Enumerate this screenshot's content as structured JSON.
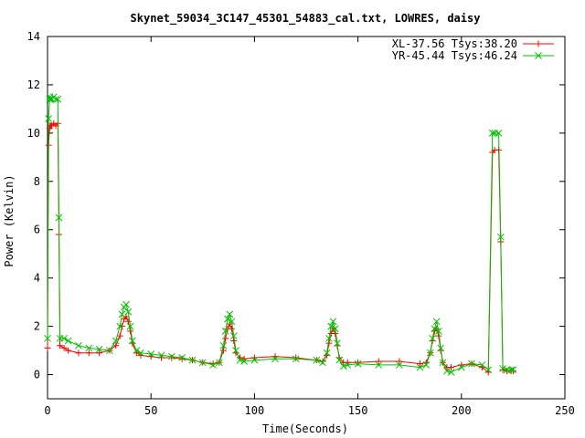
{
  "chart_data": {
    "type": "line",
    "title": "Skynet_59034_3C147_45301_54883_cal.txt, LOWRES, daisy",
    "xlabel": "Time(Seconds)",
    "ylabel": "Power (Kelvin)",
    "xlim": [
      0,
      250
    ],
    "ylim": [
      -1,
      14
    ],
    "xticks": [
      0,
      50,
      100,
      150,
      200,
      250
    ],
    "yticks": [
      0,
      2,
      4,
      6,
      8,
      10,
      12,
      14
    ],
    "grid": false,
    "legend_position": "top-right",
    "series": [
      {
        "name": "XL-37.56 Tsys:38.20",
        "color": "#ff0000",
        "marker": "plus",
        "x": [
          0,
          0.5,
          1.0,
          1.2,
          1.5,
          2,
          3,
          4,
          5,
          5.5,
          6,
          8,
          10,
          15,
          20,
          25,
          30,
          33,
          35,
          36,
          37,
          38,
          39,
          40,
          41,
          43,
          45,
          50,
          55,
          60,
          65,
          70,
          75,
          80,
          83,
          85,
          86,
          87,
          88,
          89,
          90,
          91,
          93,
          95,
          100,
          110,
          120,
          130,
          133,
          135,
          136,
          137,
          138,
          139,
          140,
          141,
          143,
          145,
          150,
          160,
          170,
          180,
          183,
          185,
          186,
          187,
          188,
          189,
          190,
          191,
          193,
          195,
          200,
          205,
          210,
          213,
          215,
          216,
          218,
          219,
          220,
          222,
          224,
          225
        ],
        "y": [
          1.1,
          9.5,
          10.2,
          10.3,
          10.3,
          10.3,
          10.4,
          10.3,
          10.4,
          5.8,
          1.2,
          1.1,
          1.0,
          0.9,
          0.9,
          0.9,
          1.0,
          1.2,
          1.6,
          2.0,
          2.3,
          2.4,
          2.2,
          1.8,
          1.3,
          0.9,
          0.8,
          0.75,
          0.7,
          0.7,
          0.65,
          0.6,
          0.5,
          0.45,
          0.5,
          1.0,
          1.5,
          1.9,
          2.1,
          1.9,
          1.4,
          0.9,
          0.7,
          0.65,
          0.7,
          0.75,
          0.7,
          0.6,
          0.55,
          0.8,
          1.3,
          1.7,
          1.9,
          1.7,
          1.2,
          0.7,
          0.5,
          0.5,
          0.5,
          0.55,
          0.55,
          0.45,
          0.5,
          0.9,
          1.4,
          1.8,
          1.9,
          1.6,
          1.0,
          0.5,
          0.3,
          0.3,
          0.4,
          0.45,
          0.3,
          0.1,
          9.2,
          9.3,
          9.3,
          5.5,
          0.2,
          0.15,
          0.15,
          0.15
        ]
      },
      {
        "name": "YR-45.44 Tsys:46.24",
        "color": "#00c000",
        "marker": "cross",
        "x": [
          0,
          0.5,
          1.0,
          1.2,
          1.5,
          2,
          3,
          4,
          5,
          5.5,
          6,
          8,
          10,
          15,
          20,
          25,
          30,
          33,
          35,
          36,
          37,
          38,
          39,
          40,
          41,
          43,
          45,
          50,
          55,
          60,
          65,
          70,
          75,
          80,
          83,
          85,
          86,
          87,
          88,
          89,
          90,
          91,
          93,
          95,
          100,
          110,
          120,
          130,
          133,
          135,
          136,
          137,
          138,
          139,
          140,
          141,
          143,
          145,
          150,
          160,
          170,
          180,
          183,
          185,
          186,
          187,
          188,
          189,
          190,
          191,
          193,
          195,
          200,
          205,
          210,
          213,
          215,
          216,
          218,
          219,
          220,
          222,
          224,
          225
        ],
        "y": [
          1.5,
          10.6,
          11.4,
          11.5,
          11.4,
          11.4,
          11.5,
          11.4,
          11.4,
          6.5,
          1.5,
          1.5,
          1.4,
          1.2,
          1.1,
          1.05,
          1.0,
          1.4,
          2.0,
          2.5,
          2.8,
          2.9,
          2.6,
          2.0,
          1.4,
          1.0,
          0.9,
          0.85,
          0.8,
          0.75,
          0.7,
          0.6,
          0.5,
          0.4,
          0.5,
          1.2,
          1.8,
          2.3,
          2.5,
          2.2,
          1.6,
          1.0,
          0.6,
          0.55,
          0.6,
          0.65,
          0.65,
          0.6,
          0.5,
          0.9,
          1.5,
          2.0,
          2.2,
          1.9,
          1.3,
          0.6,
          0.35,
          0.4,
          0.45,
          0.4,
          0.4,
          0.3,
          0.4,
          0.9,
          1.5,
          1.9,
          2.2,
          1.8,
          1.1,
          0.5,
          0.15,
          0.1,
          0.3,
          0.45,
          0.4,
          0.2,
          10.0,
          10.0,
          10.0,
          5.7,
          0.25,
          0.2,
          0.2,
          0.2
        ]
      }
    ]
  }
}
